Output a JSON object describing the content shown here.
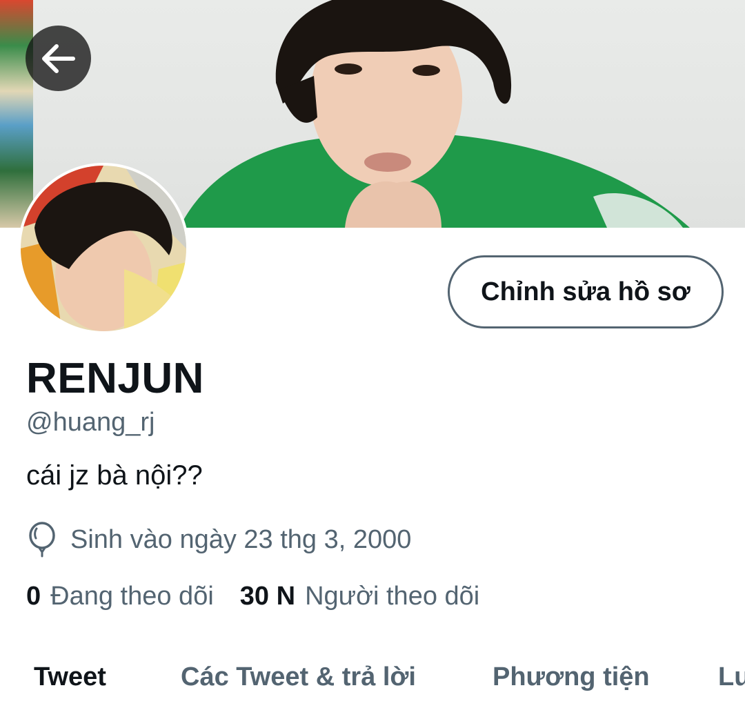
{
  "header": {
    "back_icon": "arrow-left-icon"
  },
  "profile": {
    "edit_button_label": "Chỉnh sửa hồ sơ",
    "display_name": "RENJUN",
    "handle": "@huang_rj",
    "bio": "cái jz bà nội??",
    "birthday_icon": "balloon-icon",
    "birthday_text": "Sinh vào ngày 23 thg 3, 2000",
    "following_count": "0",
    "following_label": "Đang theo dõi",
    "followers_count": "30 N",
    "followers_label": "Người theo dõi"
  },
  "tabs": [
    {
      "label": "Tweet",
      "active": true
    },
    {
      "label": "Các Tweet & trả lời",
      "active": false
    },
    {
      "label": "Phương tiện",
      "active": false
    },
    {
      "label": "Lư",
      "active": false
    }
  ],
  "colors": {
    "text_primary": "#0f1419",
    "text_secondary": "#536471",
    "jacket_green": "#1f9a4a"
  }
}
